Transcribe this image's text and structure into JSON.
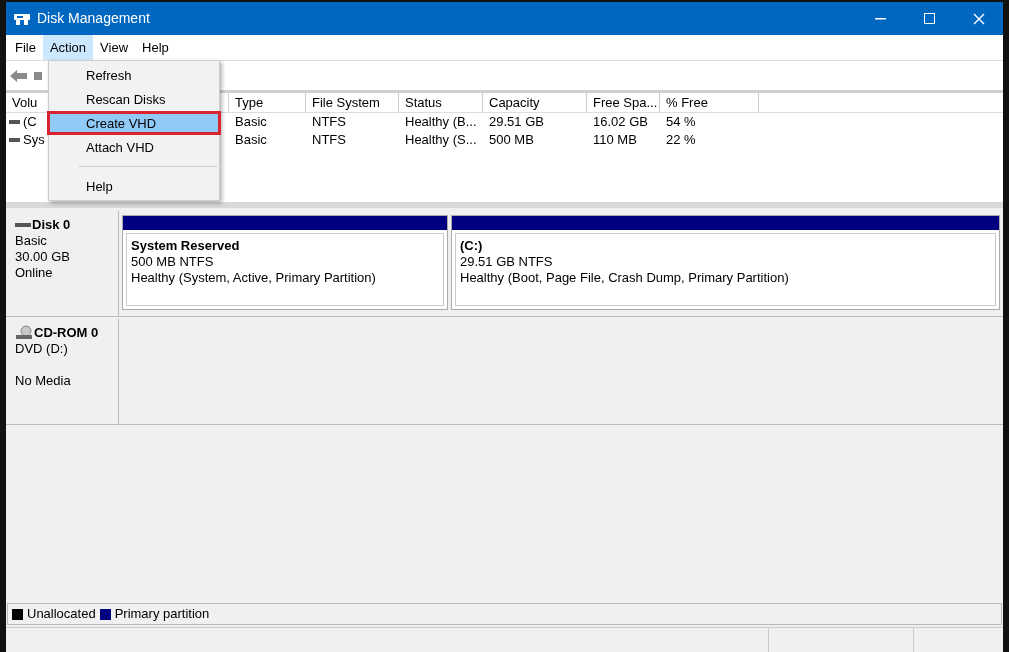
{
  "window": {
    "title": "Disk Management"
  },
  "menu_bar": [
    {
      "label": "File",
      "selected": false
    },
    {
      "label": "Action",
      "selected": true
    },
    {
      "label": "View",
      "selected": false
    },
    {
      "label": "Help",
      "selected": false
    }
  ],
  "action_menu": [
    {
      "kind": "item",
      "label": "Refresh",
      "selected": false
    },
    {
      "kind": "item",
      "label": "Rescan Disks",
      "selected": false
    },
    {
      "kind": "item",
      "label": "Create VHD",
      "selected": true
    },
    {
      "kind": "item",
      "label": "Attach VHD",
      "selected": false
    },
    {
      "kind": "separator"
    },
    {
      "kind": "item",
      "label": "Help",
      "selected": false
    }
  ],
  "volume_table": {
    "columns": [
      "Volu",
      "Type",
      "File System",
      "Status",
      "Capacity",
      "Free Spa...",
      "% Free"
    ],
    "rows": [
      [
        "(C",
        "Basic",
        "NTFS",
        "Healthy (B...",
        "29.51 GB",
        "16.02 GB",
        "54 %"
      ],
      [
        "Sys",
        "Basic",
        "NTFS",
        "Healthy (S...",
        "500 MB",
        "110 MB",
        "22 %"
      ]
    ]
  },
  "disks": [
    {
      "kind": "disk",
      "name": "Disk 0",
      "lines": [
        "Basic",
        "30.00 GB",
        "Online"
      ],
      "partitions": [
        {
          "name": "System Reserved",
          "size": "500 MB NTFS",
          "status": "Healthy (System, Active, Primary Partition)",
          "color": "#000080"
        },
        {
          "name": "(C:)",
          "size": "29.51 GB NTFS",
          "status": "Healthy (Boot, Page File, Crash Dump, Primary Partition)",
          "color": "#000080"
        }
      ]
    },
    {
      "kind": "cdrom",
      "name": "CD-ROM 0",
      "lines": [
        "DVD (D:)",
        "No Media"
      ]
    }
  ],
  "legend": [
    {
      "label": "Unallocated",
      "color": "#000000"
    },
    {
      "label": "Primary partition",
      "color": "#000080"
    }
  ]
}
